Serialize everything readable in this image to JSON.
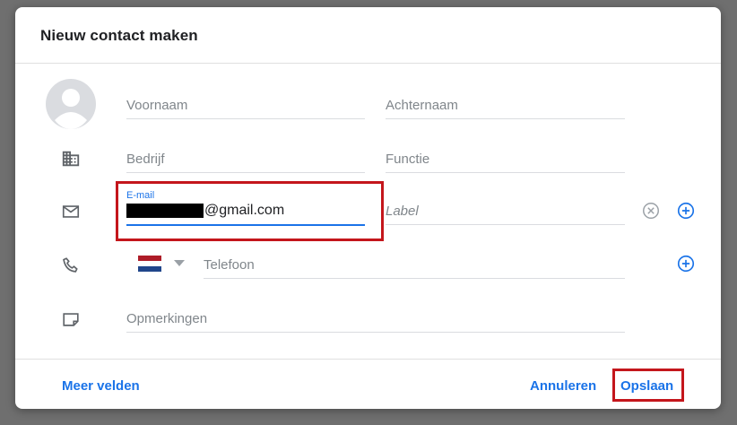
{
  "dialog": {
    "title": "Nieuw contact maken"
  },
  "fields": {
    "first_name_placeholder": "Voornaam",
    "last_name_placeholder": "Achternaam",
    "company_placeholder": "Bedrijf",
    "job_title_placeholder": "Functie",
    "email_label": "E-mail",
    "email_value_suffix": "@gmail.com",
    "email_label_placeholder": "Label",
    "phone_placeholder": "Telefoon",
    "notes_placeholder": "Opmerkingen"
  },
  "icons": {
    "avatar": "person-avatar-icon",
    "company": "building-icon",
    "email": "mail-icon",
    "phone": "phone-icon",
    "notes": "note-icon",
    "clear": "clear-circle-icon",
    "add": "add-circle-icon"
  },
  "phone_country_flag": {
    "colors": [
      "#ae1c28",
      "#ffffff",
      "#21468b"
    ]
  },
  "footer": {
    "more_fields": "Meer velden",
    "cancel": "Annuleren",
    "save": "Opslaan"
  },
  "colors": {
    "accent": "#1a73e8",
    "highlight": "#c4161c"
  }
}
